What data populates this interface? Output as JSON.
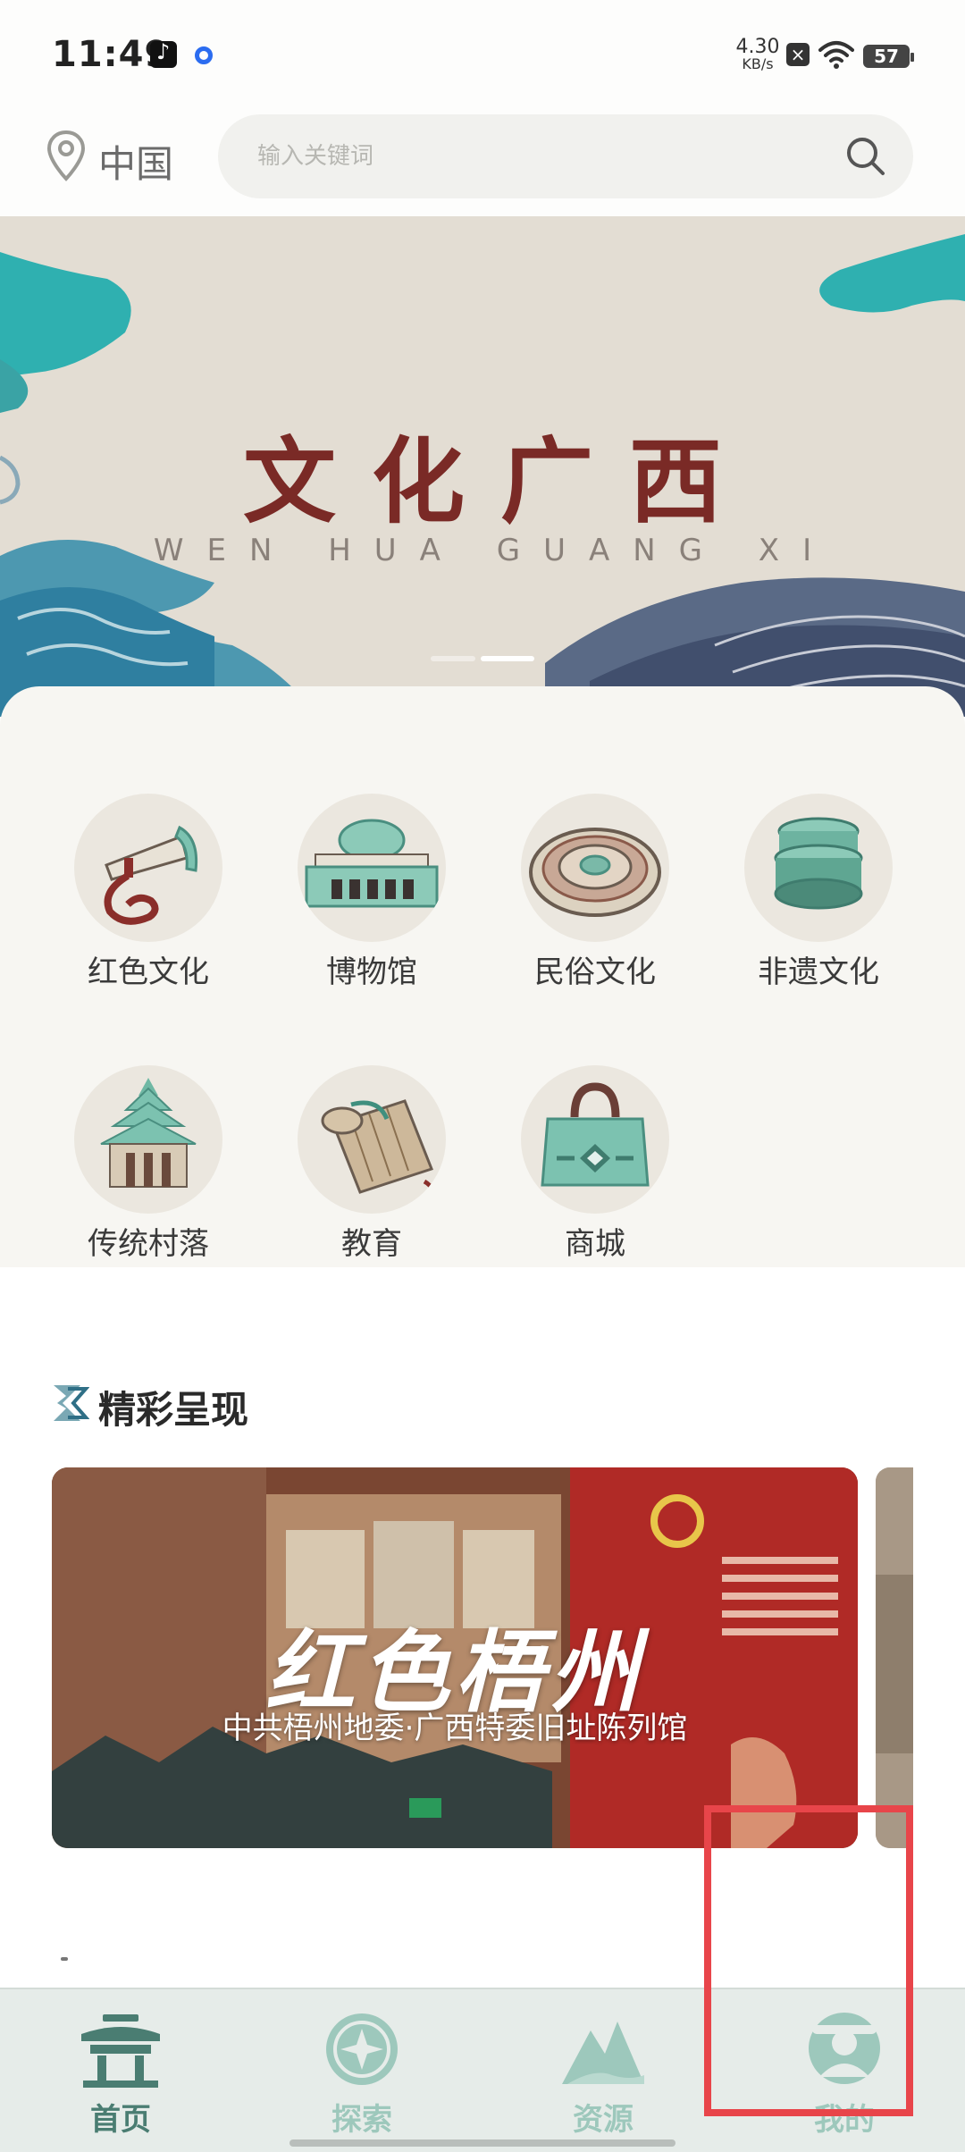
{
  "status_bar": {
    "time": "11:49",
    "net_speed_value": "4.30",
    "net_speed_unit": "KB/s",
    "battery": "57"
  },
  "header": {
    "location": "中国",
    "search_placeholder": "输入关键词"
  },
  "banner": {
    "title": "文化广西",
    "subtitle": "WEN HUA GUANG XI"
  },
  "categories": [
    {
      "label": "红色文化",
      "icon": "trumpet-icon"
    },
    {
      "label": "博物馆",
      "icon": "museum-icon"
    },
    {
      "label": "民俗文化",
      "icon": "bronze-drum-icon"
    },
    {
      "label": "非遗文化",
      "icon": "drum-stack-icon"
    },
    {
      "label": "传统村落",
      "icon": "drum-tower-icon"
    },
    {
      "label": "教育",
      "icon": "scroll-icon"
    },
    {
      "label": "商城",
      "icon": "bag-icon"
    }
  ],
  "section": {
    "title": "精彩呈现"
  },
  "feature_card": {
    "title": "红色梧州",
    "subtitle": "中共梧州地委·广西特委旧址陈列馆"
  },
  "tabs": [
    {
      "label": "首页",
      "icon": "pavilion-icon",
      "active": true
    },
    {
      "label": "探索",
      "icon": "compass-icon",
      "active": false
    },
    {
      "label": "资源",
      "icon": "mountain-icon",
      "active": false
    },
    {
      "label": "我的",
      "icon": "user-icon",
      "active": false
    }
  ],
  "colors": {
    "accent": "#3f8f7e",
    "active_tab": "#4a7d72",
    "inactive_tab": "#9dc8bc",
    "banner_title": "#7a2a26",
    "highlight": "#e8454a"
  }
}
